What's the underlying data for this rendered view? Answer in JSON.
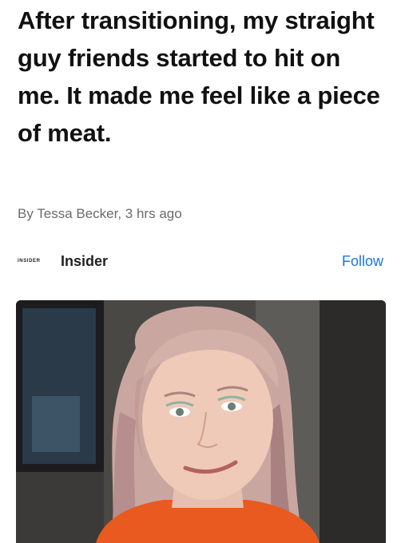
{
  "article": {
    "headline": "After transitioning, my straight guy friends started to hit on me. It made me feel like a piece of meat.",
    "byline": "By Tessa Becker, 3 hrs ago"
  },
  "source": {
    "logo_text": "INSIDER",
    "name": "Insider",
    "follow_label": "Follow"
  },
  "colors": {
    "accent": "#1a73e8",
    "byline": "#6b6b6b"
  }
}
